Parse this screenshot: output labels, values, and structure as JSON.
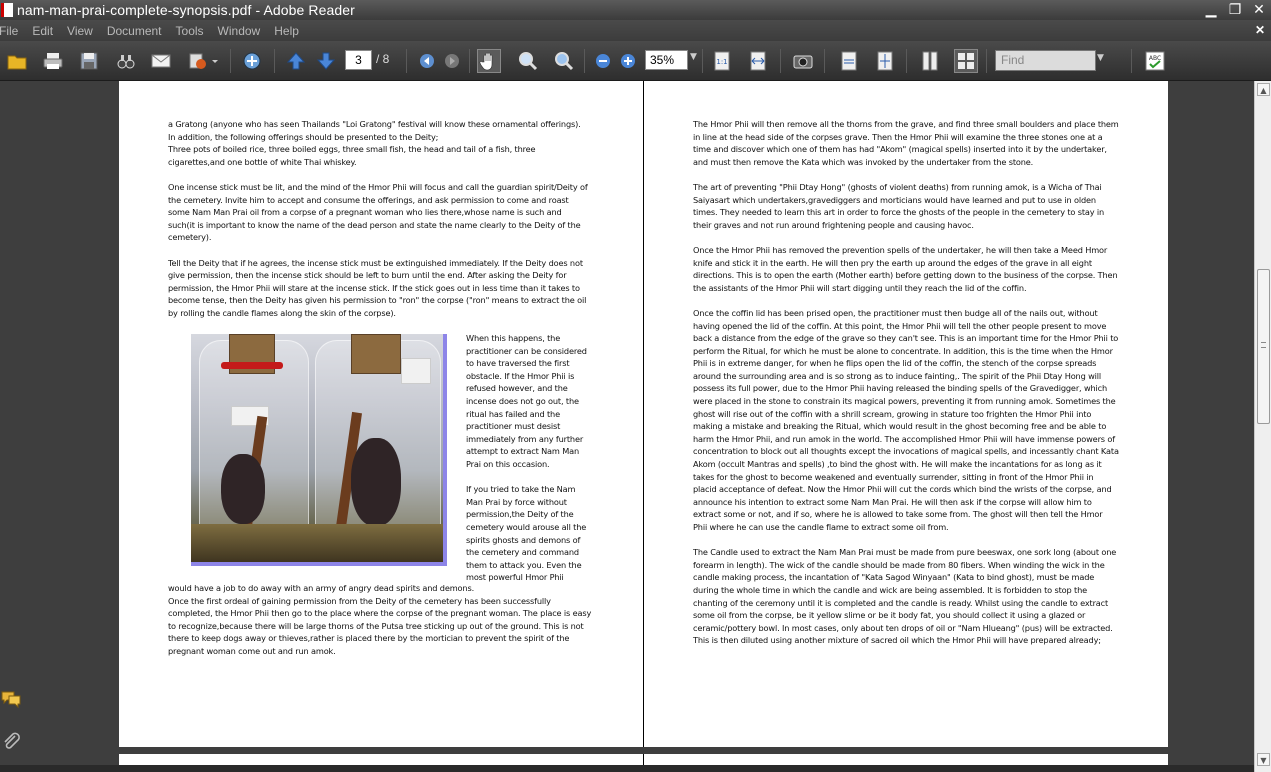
{
  "window": {
    "title": "nam-man-prai-complete-synopsis.pdf - Adobe Reader",
    "minimize": "▁",
    "restore": "❐",
    "close": "✕"
  },
  "menu": {
    "items": [
      "File",
      "Edit",
      "View",
      "Document",
      "Tools",
      "Window",
      "Help"
    ],
    "close_doc": "✕"
  },
  "toolbar": {
    "current_page": "3",
    "total_pages": "/ 8",
    "zoom": "35%",
    "find_placeholder": "Find",
    "icons": [
      "open-folder-icon",
      "print-icon",
      "save-icon",
      "search-binoculars-icon",
      "email-icon",
      "share-icon",
      "collaborate-icon",
      "prev-page-icon",
      "next-page-icon",
      "go-back-icon",
      "go-forward-icon",
      "hand-tool-icon",
      "select-zoom-icon",
      "dynamic-zoom-icon",
      "zoom-out-icon",
      "zoom-in-icon",
      "actual-size-icon",
      "fit-width-icon",
      "snapshot-icon",
      "fit-page-icon",
      "fit-window-icon",
      "single-page-icon",
      "two-up-icon",
      "spellcheck-icon"
    ]
  },
  "left_page": {
    "p1": "a Gratong (anyone who has seen Thailands \"Loi Gratong\" festival will know these ornamental offerings). In addition, the following offerings should be presented to the Deity;",
    "p1b": "Three pots of boiled rice, three boiled eggs, three small fish, the head and tail of a fish, three cigarettes,and one bottle of white Thai whiskey.",
    "p2": "One incense stick must be lit, and the mind of the Hmor Phii will focus and call the guardian spirit/Deity of the cemetery. Invite him to accept and consume the offerings, and ask permission to come and roast some Nam Man Prai oil from a corpse of a pregnant woman who lies there,whose name is such and such(it is important to know the name of the dead person and state the name clearly to the Deity of the cemetery).",
    "p3": "Tell the Deity that if he agrees, the incense stick must be extinguished immediately. If the Deity does not give permission, then the incense stick should be left to burn until the end. After asking the Deity for permission, the Hmor Phii will stare at the incense stick. If the stick goes out in less time than it takes to become tense, then the Deity has given his permission to \"ron\" the corpse (\"ron\" means to extract the oil by rolling the candle flames along the skin of the corpse).",
    "side1": "When this happens, the practitioner can be considered to have traversed the first obstacle. If the Hmor Phii is refused however, and the incense does not go out, the ritual has failed and the practitioner must desist immediately from any further attempt to extract Nam Man Prai on this occasion.",
    "side2": "If you tried to take the Nam Man Prai by force without permission,the Deity of the cemetery would arouse all the spirits ghosts and demons of the cemetery and command them to attack you. Even the most powerful Hmor Phii",
    "p4": "would have a job to do away with an army of angry dead spirits and demons.",
    "p5": "Once the first ordeal of gaining permission from the Deity of the cemetery has been successfully completed, the Hmor Phii then go to the place where the corpse of the pregnant woman. The place is easy to recognize,because there will be large thorns of the Putsa tree sticking up out of the ground. This is not there to keep dogs away or thieves,rather is placed there by the mortician to  prevent the spirit of the pregnant woman come out and run amok."
  },
  "right_page": {
    "p1": "The Hmor Phii will then remove all the thorns from the grave, and find three small boulders and place them in line at the head side of the corpses grave. Then the Hmor Phii will examine the three stones one at a time and discover which one of them has had \"Akom\" (magical spells) inserted into it by the undertaker, and must then remove the Kata which was invoked by the undertaker from the stone.",
    "p2": "The art of preventing \"Phii Dtay Hong\" (ghosts of violent deaths) from running amok, is a Wicha of Thai Saiyasart which undertakers,gravediggers and morticians would have learned and put to use in olden times. They needed to learn this art in order to force the ghosts of the people in the cemetery to stay in their graves and not run around frightening people and causing havoc.",
    "p3": "Once the Hmor Phii has removed the prevention spells of the undertaker, he will then take a Meed Hmor knife and stick it in the earth. He will then pry the earth up around the edges of the grave in all eight directions. This is to open the earth (Mother earth) before getting down to the business of the corpse. Then the assistants of the Hmor Phii will start digging until they reach the lid of the coffin.",
    "p4": " Once the coffin lid has been prised open, the practitioner must then budge all of the nails out, without having opened the lid of the coffin. At this point, the Hmor Phii will tell the other people present to move back a distance from the edge of the grave so they can't see. This is an important time for the Hmor Phii to perform the Ritual, for which he must be alone to concentrate. In addition, this is the time when the Hmor Phii is in extreme danger, for when he flips open the lid of the coffin, the stench of the corpse spreads around the surrounding area and is so strong as to induce fainting,. The spirit of the Phii Dtay Hong will possess its full power, due to the Hmor Phii having released the binding spells of the Gravedigger, which were placed in the stone to constrain its magical powers, preventing it from running amok. Sometimes the ghost will rise out of the coffin with a shrill scream, growing in stature too frighten the Hmor Phii into making a mistake and breaking  the Ritual, which would result in the ghost becoming free and be able to harm the Hmor Phii, and run amok in the world. The accomplished Hmor Phii will have immense powers of concentration to block out all thoughts except the invocations of magical spells, and incessantly chant Kata Akom (occult Mantras and spells) ,to bind the ghost with. He will make the incantations for as long as it takes for the ghost to become weakened and eventually surrender, sitting in front of the Hmor Phii  in placid acceptance of defeat. Now the Hmor Phii will cut the cords which bind the wrists of the corpse, and announce his intention to extract some Nam Man Prai. He will then ask if the corpse will allow him to extract some or not, and if so, where he is allowed to take some from. The ghost will then tell the Hmor Phii where he can use the candle flame to extract some oil from.",
    "p5": "The Candle used to extract the Nam Man Prai must be made from pure beeswax, one sork long (about one forearm in length). The wick of the candle should be made from 80 fibers. When winding the wick in the candle making process, the incantation of \"Kata Sagod Winyaan\"  (Kata to bind ghost), must be made during the whole time in which the candle and wick are being assembled.  It is forbidden to stop the chanting of the ceremony until it is completed and the candle is ready. Whilst using the candle to extract some oil from the corpse,  be it yellow slime or be it body fat, you should collect it using a glazed or ceramic/pottery bowl. In most cases, only about ten drops of oil or \"Nam Hlueang\" (pus) will be extracted. This is then diluted using another mixture of sacred oil which the Hmor Phii will have prepared already;"
  }
}
